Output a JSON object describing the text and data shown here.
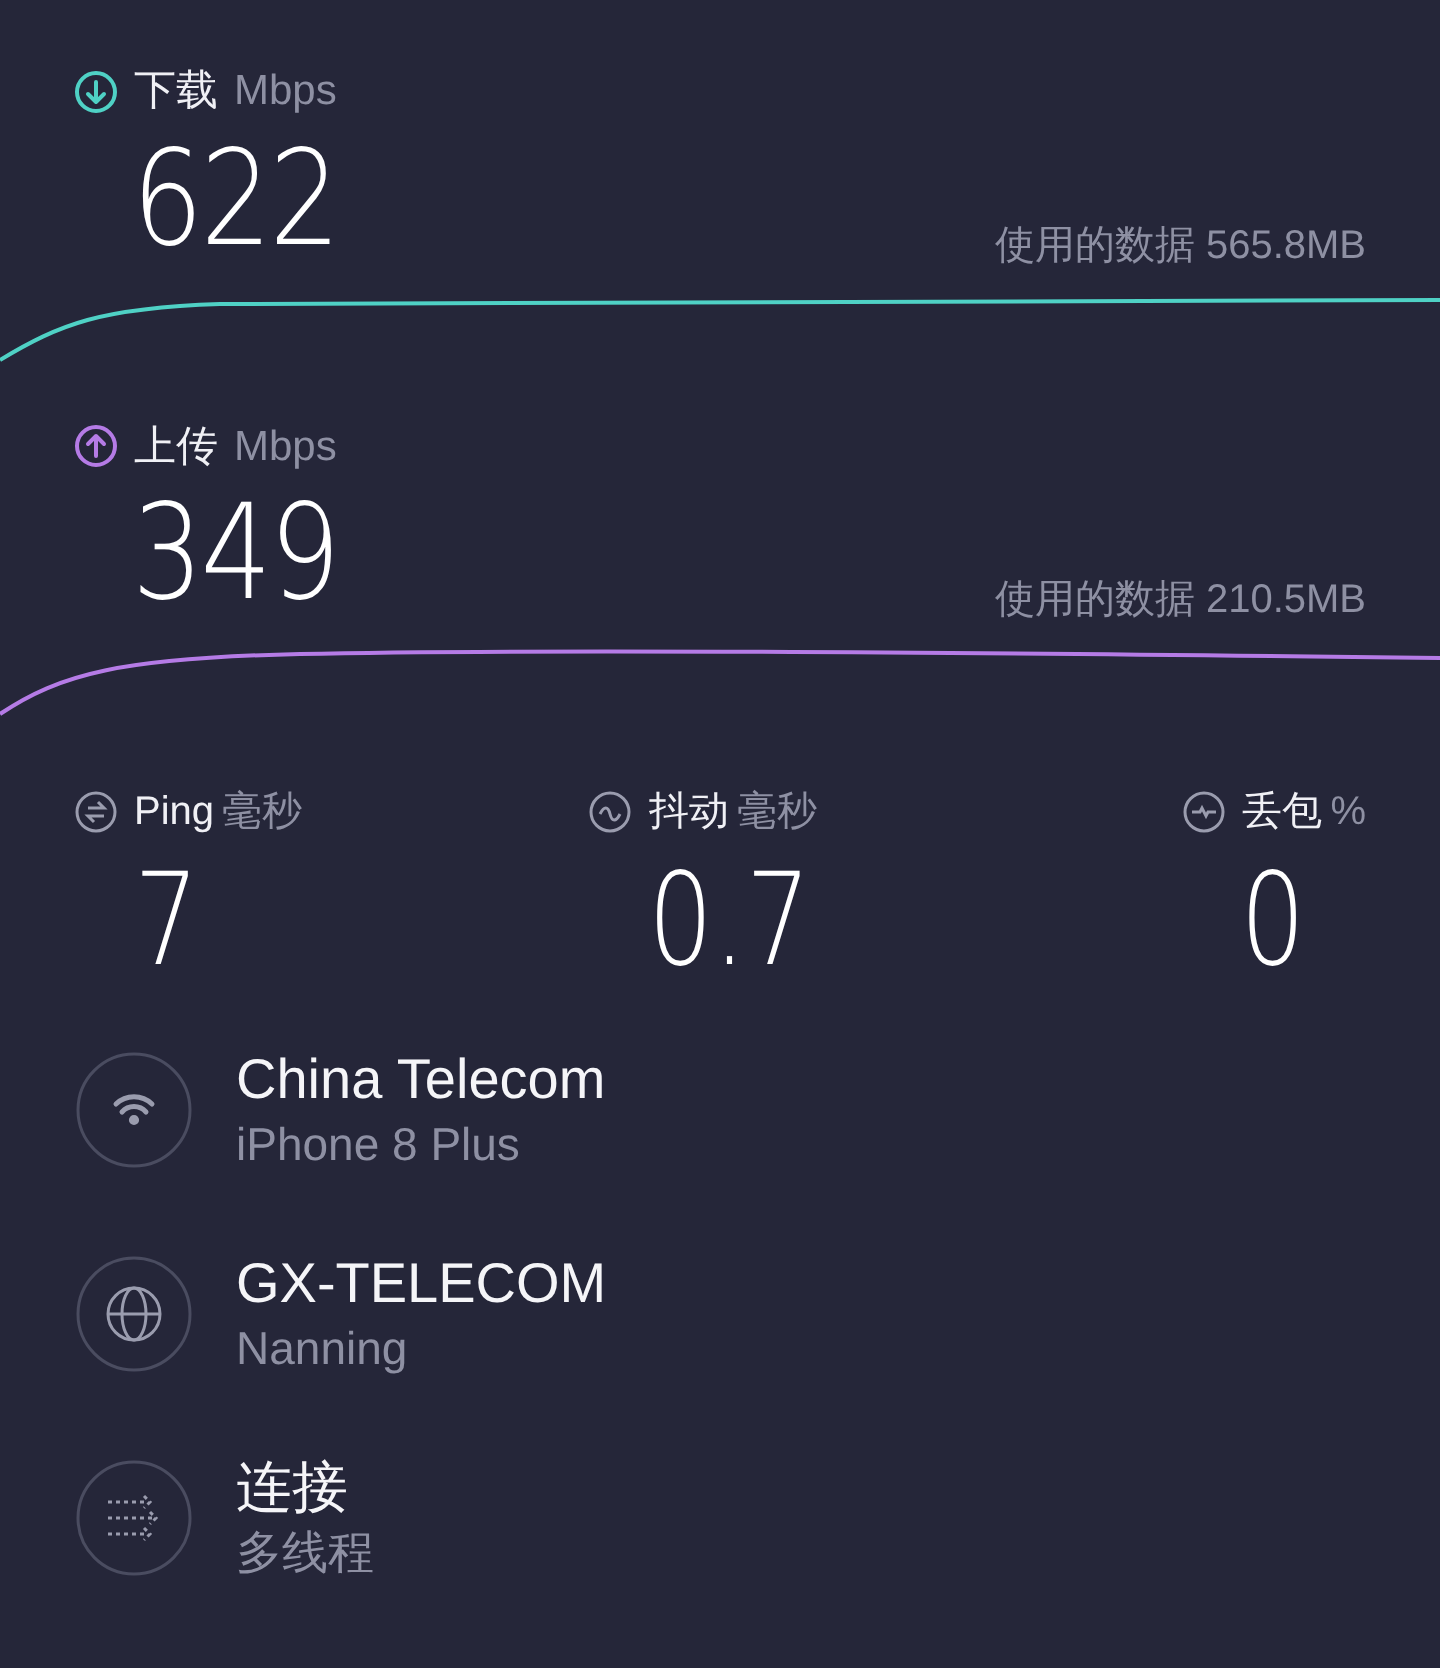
{
  "speeds": [
    {
      "kind": "download",
      "label": "下载",
      "unit": "Mbps",
      "value": "622",
      "data_used": "使用的数据 565.8MB",
      "color": "#4fd1c5"
    },
    {
      "kind": "upload",
      "label": "上传",
      "unit": "Mbps",
      "value": "349",
      "data_used": "使用的数据 210.5MB",
      "color": "#b57be6"
    }
  ],
  "stats": [
    {
      "kind": "ping",
      "label": "Ping",
      "unit": "毫秒",
      "value": "7"
    },
    {
      "kind": "jitter",
      "label": "抖动",
      "unit": "毫秒",
      "value": "0.7"
    },
    {
      "kind": "loss",
      "label": "丢包",
      "unit": "%",
      "value": "0"
    }
  ],
  "info": [
    {
      "kind": "wifi",
      "title": "China Telecom",
      "subtitle": "iPhone 8 Plus"
    },
    {
      "kind": "globe",
      "title": "GX-TELECOM",
      "subtitle": "Nanning"
    },
    {
      "kind": "connections",
      "title": "连接",
      "subtitle": "多线程"
    }
  ]
}
